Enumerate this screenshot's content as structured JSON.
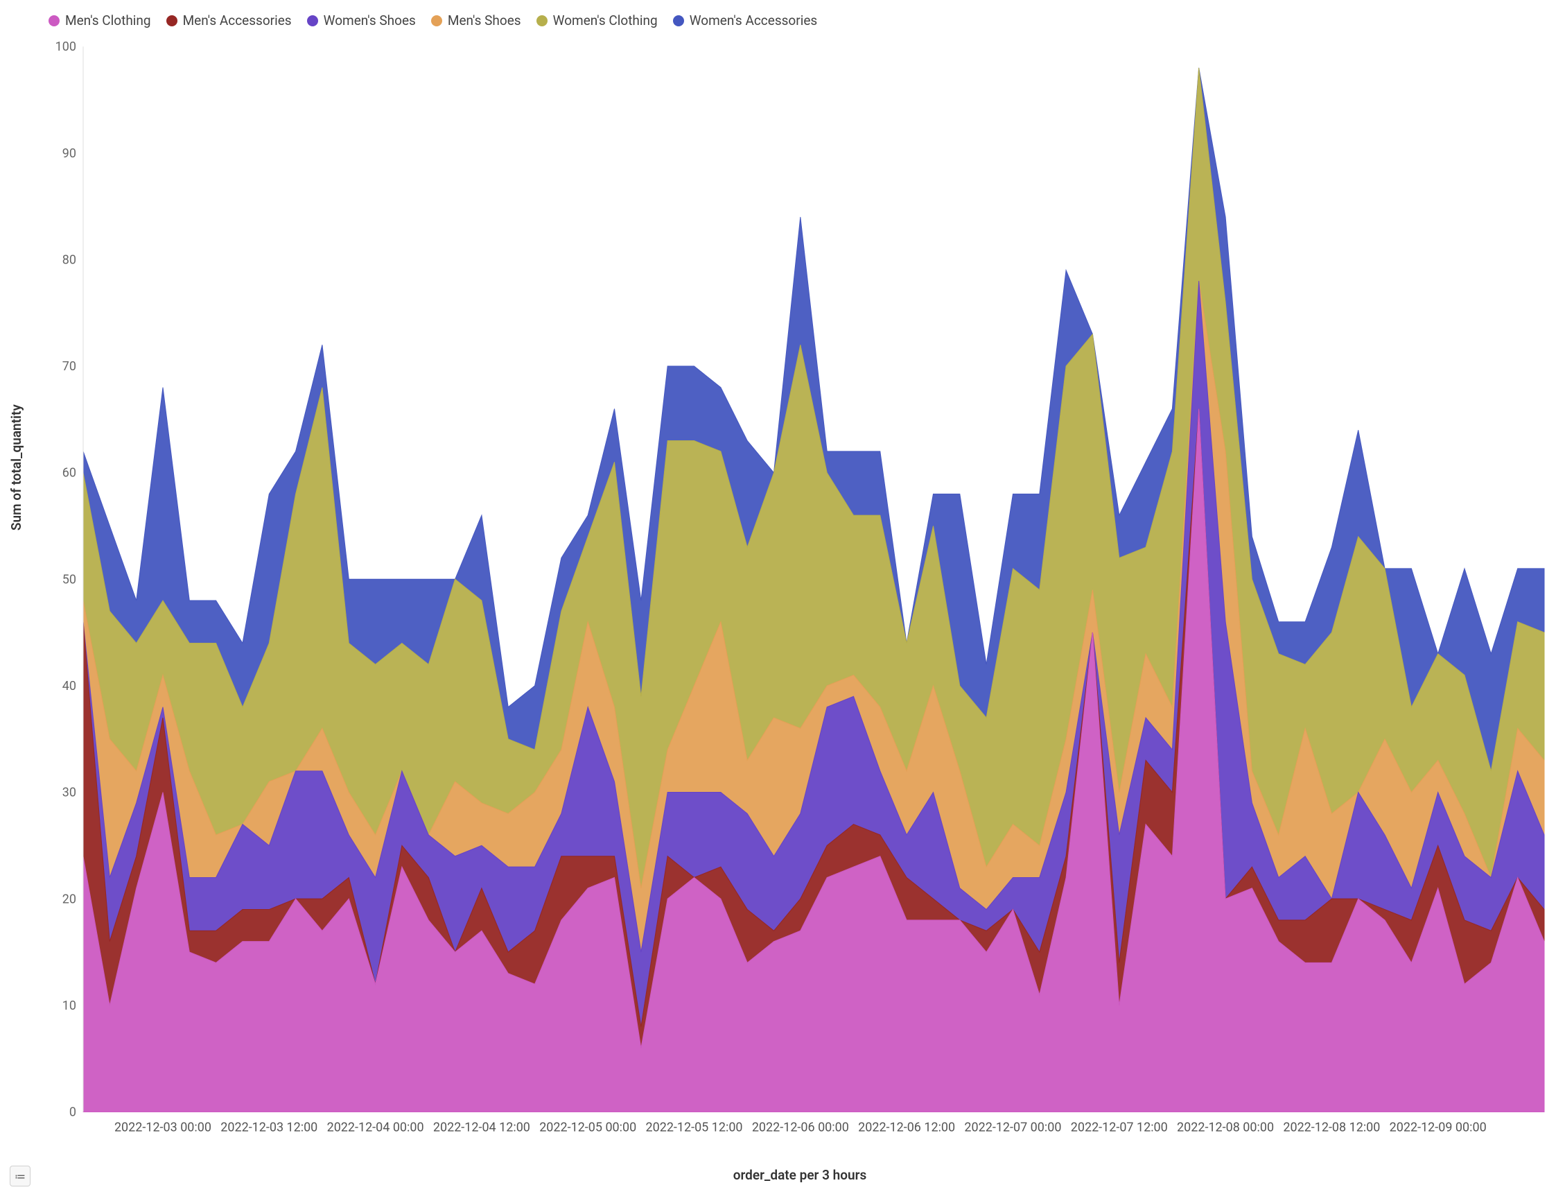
{
  "chart_data": {
    "type": "area",
    "title": "",
    "xlabel": "order_date per 3 hours",
    "ylabel": "Sum of total_quantity",
    "ylim": [
      0,
      100
    ],
    "y_ticks": [
      0,
      10,
      20,
      30,
      40,
      50,
      60,
      70,
      80,
      90,
      100
    ],
    "x_tick_labels": [
      "2022-12-03 00:00",
      "2022-12-03 12:00",
      "2022-12-04 00:00",
      "2022-12-04 12:00",
      "2022-12-05 00:00",
      "2022-12-05 12:00",
      "2022-12-06 00:00",
      "2022-12-06 12:00",
      "2022-12-07 00:00",
      "2022-12-07 12:00",
      "2022-12-08 00:00",
      "2022-12-08 12:00",
      "2022-12-09 00:00"
    ],
    "x_tick_indices": [
      3,
      7,
      11,
      15,
      19,
      23,
      27,
      31,
      35,
      39,
      43,
      47,
      51
    ],
    "categories_count": 56,
    "series": [
      {
        "name": "Men's Clothing",
        "color": "#cc5ac2",
        "values": [
          24,
          10,
          21,
          30,
          15,
          14,
          16,
          16,
          20,
          17,
          20,
          12,
          23,
          18,
          15,
          17,
          13,
          12,
          18,
          21,
          22,
          6,
          20,
          22,
          20,
          14,
          16,
          17,
          22,
          23,
          24,
          18,
          18,
          18,
          15,
          19,
          11,
          22,
          45,
          10,
          27,
          24,
          66,
          20,
          21,
          16,
          14,
          14,
          20,
          18,
          14,
          21,
          12,
          14,
          22,
          16
        ]
      },
      {
        "name": "Men's Accessories",
        "color": "#962724",
        "values": [
          22,
          6,
          3,
          7,
          2,
          3,
          3,
          3,
          0,
          3,
          2,
          0,
          2,
          4,
          0,
          4,
          2,
          5,
          6,
          3,
          2,
          2,
          4,
          0,
          3,
          5,
          1,
          3,
          3,
          4,
          2,
          4,
          2,
          0,
          2,
          0,
          4,
          2,
          0,
          4,
          6,
          6,
          0,
          0,
          2,
          2,
          4,
          6,
          0,
          1,
          4,
          4,
          6,
          3,
          0,
          3
        ]
      },
      {
        "name": "Women's Shoes",
        "color": "#6644c6",
        "values": [
          0,
          6,
          5,
          1,
          5,
          5,
          8,
          6,
          12,
          12,
          4,
          10,
          7,
          4,
          9,
          4,
          8,
          6,
          4,
          14,
          7,
          7,
          6,
          8,
          7,
          9,
          7,
          8,
          13,
          12,
          6,
          4,
          10,
          3,
          2,
          3,
          7,
          6,
          0,
          12,
          4,
          4,
          12,
          26,
          6,
          4,
          6,
          0,
          10,
          7,
          3,
          5,
          6,
          5,
          10,
          7
        ]
      },
      {
        "name": "Men's Shoes",
        "color": "#e4a157",
        "values": [
          2,
          13,
          3,
          3,
          10,
          4,
          0,
          6,
          0,
          4,
          4,
          4,
          0,
          0,
          7,
          4,
          5,
          7,
          6,
          8,
          7,
          6,
          4,
          10,
          16,
          5,
          13,
          8,
          2,
          2,
          6,
          6,
          10,
          11,
          4,
          5,
          3,
          5,
          4,
          4,
          6,
          4,
          0,
          16,
          3,
          4,
          12,
          8,
          0,
          9,
          9,
          3,
          4,
          0,
          4,
          7
        ]
      },
      {
        "name": "Women's Clothing",
        "color": "#b6af4c",
        "values": [
          12,
          12,
          12,
          7,
          12,
          18,
          11,
          13,
          26,
          32,
          14,
          16,
          12,
          16,
          19,
          19,
          7,
          4,
          13,
          8,
          23,
          18,
          29,
          23,
          16,
          20,
          23,
          36,
          20,
          15,
          18,
          12,
          15,
          8,
          14,
          24,
          24,
          35,
          24,
          22,
          10,
          24,
          20,
          14,
          18,
          17,
          6,
          17,
          24,
          16,
          8,
          10,
          13,
          10,
          10,
          12
        ]
      },
      {
        "name": "Women's Accessories",
        "color": "#4457c0",
        "values": [
          2,
          8,
          4,
          20,
          4,
          4,
          6,
          14,
          4,
          4,
          6,
          8,
          6,
          8,
          0,
          8,
          3,
          6,
          5,
          2,
          5,
          9,
          7,
          7,
          6,
          10,
          0,
          12,
          2,
          6,
          6,
          0,
          3,
          18,
          5,
          7,
          9,
          9,
          0,
          4,
          8,
          4,
          0,
          8,
          4,
          3,
          4,
          8,
          10,
          0,
          13,
          0,
          10,
          11,
          5,
          6
        ]
      }
    ]
  },
  "legend": {
    "items": [
      {
        "label": "Men's Clothing",
        "color": "#cc5ac2"
      },
      {
        "label": "Men's Accessories",
        "color": "#962724"
      },
      {
        "label": "Women's Shoes",
        "color": "#6644c6"
      },
      {
        "label": "Men's Shoes",
        "color": "#e4a157"
      },
      {
        "label": "Women's Clothing",
        "color": "#b6af4c"
      },
      {
        "label": "Women's Accessories",
        "color": "#4457c0"
      }
    ]
  },
  "bottom_toggle_glyph": "≔"
}
